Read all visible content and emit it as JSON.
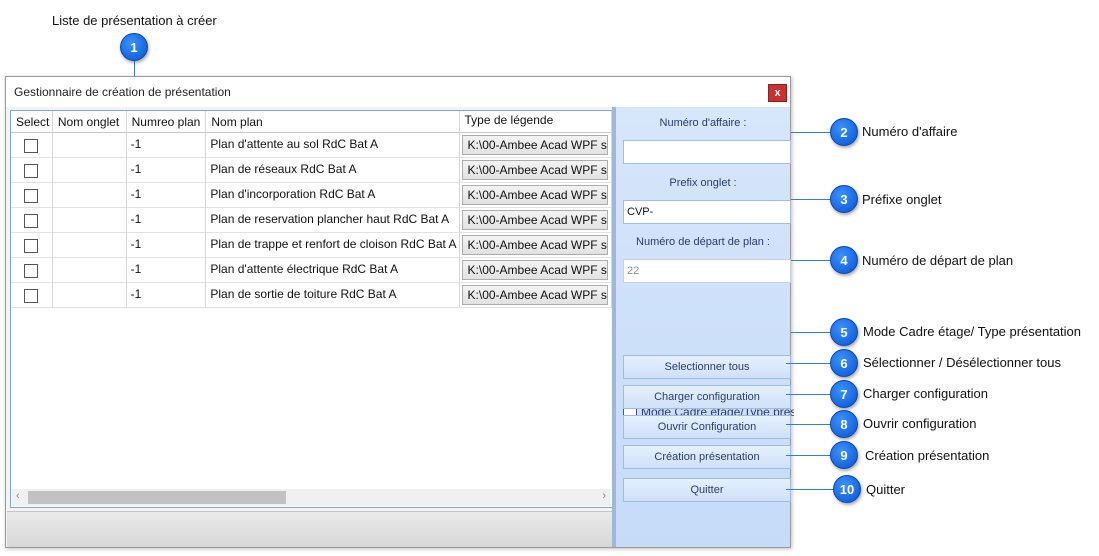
{
  "annotations": {
    "top_label": "Liste de présentation à créer",
    "callouts": [
      {
        "num": "1"
      },
      {
        "num": "2",
        "text": "Numéro d'affaire"
      },
      {
        "num": "3",
        "text": "Préfixe onglet"
      },
      {
        "num": "4",
        "text": "Numéro de départ de plan"
      },
      {
        "num": "5",
        "text": "Mode Cadre étage/  Type présentation"
      },
      {
        "num": "6",
        "text": "Sélectionner / Désélectionner tous"
      },
      {
        "num": "7",
        "text": "Charger configuration"
      },
      {
        "num": "8",
        "text": "Ouvrir configuration"
      },
      {
        "num": "9",
        "text": "Création présentation"
      },
      {
        "num": "10",
        "text": "Quitter"
      }
    ]
  },
  "window": {
    "title": "Gestionnaire de création de présentation",
    "close_label": "x"
  },
  "grid": {
    "columns": [
      "Select",
      "Nom onglet",
      "Numreo plan",
      "Nom plan",
      "Type de légende"
    ],
    "rows": [
      {
        "checked": false,
        "onglet": "",
        "numero": "-1",
        "nom": "Plan d'attente au sol RdC Bat A",
        "type": "K:\\00-Ambee Acad WPF s"
      },
      {
        "checked": false,
        "onglet": "",
        "numero": "-1",
        "nom": "Plan de réseaux RdC Bat A",
        "type": "K:\\00-Ambee Acad WPF s"
      },
      {
        "checked": false,
        "onglet": "",
        "numero": "-1",
        "nom": "Plan d'incorporation RdC Bat A",
        "type": "K:\\00-Ambee Acad WPF s"
      },
      {
        "checked": false,
        "onglet": "",
        "numero": "-1",
        "nom": "Plan de reservation plancher haut RdC Bat A",
        "type": "K:\\00-Ambee Acad WPF s"
      },
      {
        "checked": false,
        "onglet": "",
        "numero": "-1",
        "nom": "Plan de trappe et renfort de cloison RdC Bat A",
        "type": "K:\\00-Ambee Acad WPF s"
      },
      {
        "checked": false,
        "onglet": "",
        "numero": "-1",
        "nom": "Plan d'attente électrique RdC Bat A",
        "type": "K:\\00-Ambee Acad WPF s"
      },
      {
        "checked": false,
        "onglet": "",
        "numero": "-1",
        "nom": "Plan de sortie de toiture RdC Bat A",
        "type": "K:\\00-Ambee Acad WPF s"
      }
    ],
    "scroll_left": "‹",
    "scroll_right": "›"
  },
  "panel": {
    "numero_affaire_label": "Numéro d'affaire :",
    "numero_affaire_value": "",
    "prefix_label": "Prefix onglet :",
    "prefix_value": "CVP-",
    "depart_label": "Numéro de départ de plan :",
    "depart_value": "22",
    "mode_label": "Mode Cadre etage/Type présentation",
    "mode_checked": false,
    "btn_select_all": "Selectionner tous",
    "btn_charger": "Charger configuration",
    "btn_ouvrir": "Ouvrir Configuration",
    "btn_creation": "Création présentation",
    "btn_quitter": "Quitter"
  },
  "colors": {
    "badge_blue": "#1565e0",
    "panel_blue": "#c5dbf8",
    "close_red": "#c7312f"
  }
}
